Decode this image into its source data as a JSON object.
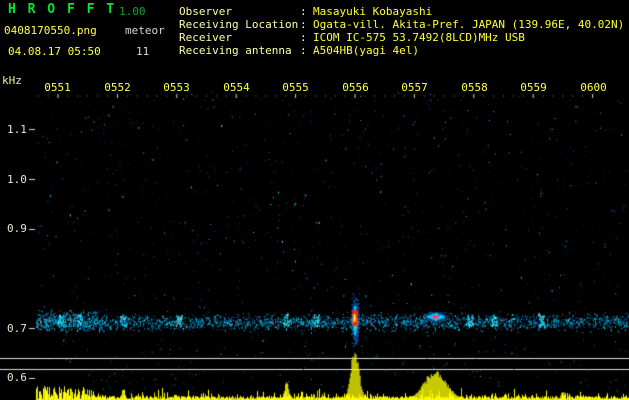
{
  "header": {
    "app_name": "H R O F F T",
    "version": "1.00",
    "filename": "0408170550.png",
    "mode": "meteor",
    "datetime": "04.08.17 05:50",
    "count": "11",
    "colon": ":",
    "info": [
      {
        "label": "Observer",
        "value": "Masayuki Kobayashi"
      },
      {
        "label": "Receiving Location",
        "value": "Ogata-vill. Akita-Pref. JAPAN (139.96E, 40.02N)"
      },
      {
        "label": "Receiver",
        "value": "ICOM IC-575 53.7492(8LCD)MHz USB"
      },
      {
        "label": "Receiving antenna",
        "value": "A504HB(yagi 4el)"
      }
    ]
  },
  "chart_data": {
    "type": "heatmap",
    "x_axis": {
      "unit": "time HHMM",
      "ticks": [
        "0551",
        "0552",
        "0553",
        "0554",
        "0555",
        "0556",
        "0557",
        "0558",
        "0559",
        "0600"
      ]
    },
    "y_axis": {
      "label": "kHz",
      "ticks": [
        "1.1",
        "1.0",
        "0.9",
        "0.7",
        "0.6"
      ],
      "range_khz": [
        0.6,
        1.15
      ]
    },
    "noise_band": {
      "freq_khz": 0.7
    },
    "echo_events": [
      {
        "time": "0556:00",
        "freq_khz": 0.7,
        "strength": "strong",
        "m": 6.0,
        "h": 46,
        "w": 4
      },
      {
        "time": "0557:21",
        "freq_khz": 0.71,
        "strength": "medium",
        "m": 7.35,
        "h": 26,
        "w": 11
      }
    ],
    "minor_echoes": [
      {
        "m": 1.05
      },
      {
        "m": 1.35
      },
      {
        "m": 2.1
      },
      {
        "m": 3.05
      },
      {
        "m": 4.85
      },
      {
        "m": 5.35
      },
      {
        "m": 7.95
      },
      {
        "m": 8.35
      },
      {
        "m": 9.15
      }
    ],
    "intensity_extra_peaks": [
      {
        "m": 4.85,
        "h": 16,
        "w": 2
      },
      {
        "m": 2.1,
        "h": 10,
        "w": 1.5
      },
      {
        "m": 9.5,
        "h": 8,
        "w": 1.5
      }
    ],
    "noise": {
      "scatter_dots": 1300,
      "band_dots": 2400
    }
  }
}
